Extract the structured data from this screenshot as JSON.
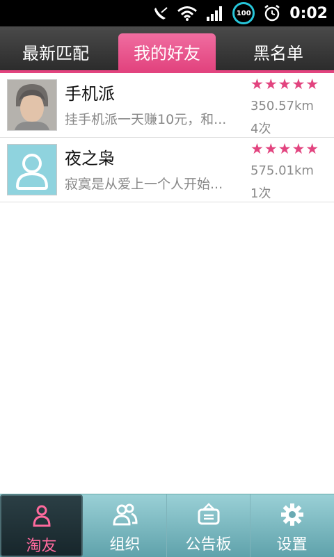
{
  "status_bar": {
    "time": "0:02",
    "battery_level": "100",
    "icons": [
      "mute-icon",
      "wifi-icon",
      "signal-icon",
      "battery-icon",
      "alarm-icon"
    ]
  },
  "tabs": [
    {
      "label": "最新匹配",
      "active": false
    },
    {
      "label": "我的好友",
      "active": true
    },
    {
      "label": "黑名单",
      "active": false
    }
  ],
  "friends": [
    {
      "name": "手机派",
      "preview": "挂手机派一天赚10元，和...",
      "stars": "★★★★★",
      "distance": "350.57km",
      "count": "4次",
      "avatar": "photo"
    },
    {
      "name": "夜之枭",
      "preview": "寂寞是从爱上一个人开始...",
      "stars": "★★★★★",
      "distance": "575.01km",
      "count": "1次",
      "avatar": "default-user"
    }
  ],
  "bottom_nav": [
    {
      "label": "淘友",
      "icon": "person-icon",
      "active": true
    },
    {
      "label": "组织",
      "icon": "group-icon",
      "active": false
    },
    {
      "label": "公告板",
      "icon": "noticeboard-icon",
      "active": false
    },
    {
      "label": "设置",
      "icon": "gear-icon",
      "active": false
    }
  ],
  "colors": {
    "accent": "#e2447f",
    "nav": "#7fbcc4",
    "avatar_bg": "#8fd3de"
  }
}
